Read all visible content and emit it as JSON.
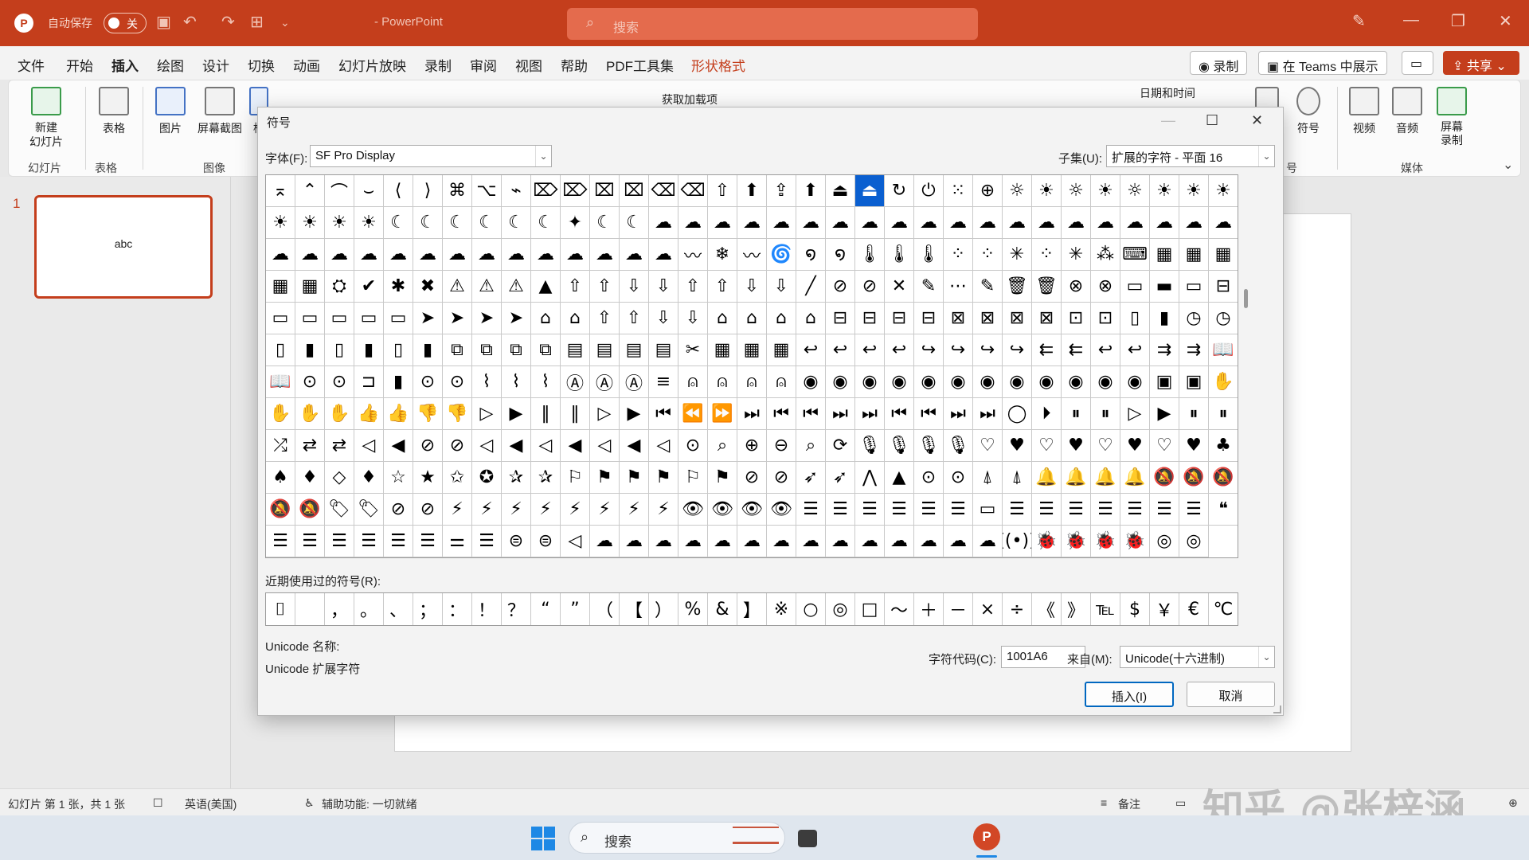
{
  "titlebar": {
    "logo": "P",
    "autosave_label": "自动保存",
    "autosave_state": "关",
    "doc_title": "- PowerPoint",
    "search_placeholder": "搜索",
    "icons": [
      "save-icon",
      "undo-icon",
      "redo-icon",
      "presentation-icon",
      "customize-icon",
      "pen-icon",
      "minimize-icon",
      "restore-icon",
      "close-icon"
    ]
  },
  "menu": {
    "tabs": [
      "文件",
      "开始",
      "插入",
      "绘图",
      "设计",
      "切换",
      "动画",
      "幻灯片放映",
      "录制",
      "审阅",
      "视图",
      "帮助",
      "PDF工具集",
      "形状格式"
    ],
    "active_tab": "插入",
    "record_btn": "录制",
    "teams_btn": "在 Teams 中展示",
    "share_btn": "共享"
  },
  "ribbon": {
    "new_slide": "新建\n幻灯片",
    "table": "表格",
    "picture": "图片",
    "screenshot": "屏幕截图",
    "get_addins": "获取加载项",
    "datetime": "日期和时间",
    "symbol": "符号",
    "video": "视频",
    "audio": "音频",
    "screen_record": "屏幕\n录制",
    "groups": {
      "slides": "幻灯片",
      "tables": "表格",
      "images": "图像",
      "symbols": "号",
      "media": "媒体"
    },
    "partial": "框"
  },
  "slides_panel": {
    "number": "1",
    "thumb_text": "abc"
  },
  "dialog": {
    "title": "符号",
    "font_label": "字体(F):",
    "font_value": "SF Pro Display",
    "subset_label": "子集(U):",
    "subset_value": "扩展的字符 - 平面 16",
    "recent_label": "近期使用过的符号(R):",
    "unicode_name_label": "Unicode 名称:",
    "unicode_name_value": "Unicode 扩展字符",
    "char_code_label": "字符代码(C):",
    "char_code_value": "1001A6",
    "from_label": "来自(M):",
    "from_value": "Unicode(十六进制)",
    "insert_btn": "插入(I)",
    "cancel_btn": "取消",
    "selected_index": 20,
    "symbols": [
      "⌅",
      "⌃",
      "⌒",
      "⌣",
      "⟨",
      "⟩",
      "⌘",
      "⌥",
      "⌁",
      "⌦",
      "⌦",
      "⌧",
      "⌧",
      "⌫",
      "⌫",
      "⇧",
      "⬆",
      "⇪",
      "⬆",
      "⏏",
      "⏏",
      "↻",
      "⏻",
      "⁙",
      "⊕",
      "☼",
      "☀",
      "☼",
      "☀",
      "☼",
      "☀",
      "☀",
      "☀",
      "☀",
      "☀",
      "☀",
      "☀",
      "☾",
      "☾",
      "☾",
      "☾",
      "☾",
      "☾",
      "✦",
      "☾",
      "☾",
      "☁",
      "☁",
      "☁",
      "☁",
      "☁",
      "☁",
      "☁",
      "☁",
      "☁",
      "☁",
      "☁",
      "☁",
      "☁",
      "☁",
      "☁",
      "☁",
      "☁",
      "☁",
      "☁",
      "☁",
      "☁",
      "☁",
      "☁",
      "☁",
      "☁",
      "☁",
      "☁",
      "☁",
      "☁",
      "☁",
      "☁",
      "☁",
      "☁",
      "☁",
      "〰",
      "❄",
      "〰",
      "🌀",
      "໑",
      "໑",
      "🌡",
      "🌡",
      "🌡",
      "⁘",
      "⁘",
      "✳",
      "⁘",
      "✳",
      "⁂",
      "⌨",
      "▦",
      "▦",
      "▦",
      "▦",
      "▦",
      "⛭",
      "✔",
      "✱",
      "✖",
      "⚠",
      "⚠",
      "⚠",
      "▲",
      "⇧",
      "⇧",
      "⇩",
      "⇩",
      "⇧",
      "⇧",
      "⇩",
      "⇩",
      "╱",
      "⊘",
      "⊘",
      "✕",
      "✎",
      "⋯",
      "✎",
      "🗑",
      "🗑",
      "⊗",
      "⊗",
      "▭",
      "▬",
      "▭",
      "⊟",
      "▭",
      "▭",
      "▭",
      "▭",
      "▭",
      "➤",
      "➤",
      "➤",
      "➤",
      "⌂",
      "⌂",
      "⇧",
      "⇧",
      "⇩",
      "⇩",
      "⌂",
      "⌂",
      "⌂",
      "⌂",
      "⊟",
      "⊟",
      "⊟",
      "⊟",
      "⊠",
      "⊠",
      "⊠",
      "⊠",
      "⊡",
      "⊡",
      "▯",
      "▮",
      "◷",
      "◷",
      "▯",
      "▮",
      "▯",
      "▮",
      "▯",
      "▮",
      "⧉",
      "⧉",
      "⧉",
      "⧉",
      "▤",
      "▤",
      "▤",
      "▤",
      "✂",
      "▦",
      "▦",
      "▦",
      "↩",
      "↩",
      "↩",
      "↩",
      "↪",
      "↪",
      "↪",
      "↪",
      "⇇",
      "⇇",
      "↩",
      "↩",
      "⇉",
      "⇉",
      "📖",
      "📖",
      "⊙",
      "⊙",
      "⊐",
      "▮",
      "⊙",
      "⊙",
      "⌇",
      "⌇",
      "⌇",
      "Ⓐ",
      "Ⓐ",
      "Ⓐ",
      "≡",
      "⍝",
      "⍝",
      "⍝",
      "⍝",
      "◉",
      "◉",
      "◉",
      "◉",
      "◉",
      "◉",
      "◉",
      "◉",
      "◉",
      "◉",
      "◉",
      "◉",
      "▣",
      "▣",
      "✋",
      "✋",
      "✋",
      "✋",
      "👍",
      "👍",
      "👎",
      "👎",
      "▷",
      "▶",
      "‖",
      "‖",
      "▷",
      "▶",
      "⏮",
      "⏪",
      "⏩",
      "⏭",
      "⏮",
      "⏮",
      "⏭",
      "⏭",
      "⏮",
      "⏮",
      "⏭",
      "⏭",
      "◯",
      "⏵",
      "⏸",
      "⏸",
      "▷",
      "▶",
      "⏸",
      "⏸",
      "⤮",
      "⇄",
      "⇄",
      "◁",
      "◀",
      "⊘",
      "⊘",
      "◁",
      "◀",
      "◁",
      "◀",
      "◁",
      "◀",
      "◁",
      "⊙",
      "⌕",
      "⊕",
      "⊖",
      "⌕",
      "⟳",
      "🎙",
      "🎙",
      "🎙",
      "🎙",
      "♡",
      "♥",
      "♡",
      "♥",
      "♡",
      "♥",
      "♡",
      "♥",
      "♣",
      "♠",
      "♦",
      "◇",
      "♦",
      "☆",
      "★",
      "✩",
      "✪",
      "✰",
      "✰",
      "⚐",
      "⚑",
      "⚑",
      "⚑",
      "⚐",
      "⚑",
      "⊘",
      "⊘",
      "➶",
      "➶",
      "⋀",
      "▲",
      "⊙",
      "⊙",
      "⍋",
      "⍋",
      "🔔",
      "🔔",
      "🔔",
      "🔔",
      "🔕",
      "🔕",
      "🔕",
      "🔕",
      "🔕",
      "🏷",
      "🏷",
      "⊘",
      "⊘",
      "⚡",
      "⚡",
      "⚡",
      "⚡",
      "⚡",
      "⚡",
      "⚡",
      "⚡",
      "👁",
      "👁",
      "👁",
      "👁",
      "☰",
      "☰",
      "☰",
      "☰",
      "☰",
      "☰",
      "▭",
      "☰",
      "☰",
      "☰",
      "☰",
      "☰",
      "☰",
      "☰",
      "❝",
      "☰",
      "☰",
      "☰",
      "☰",
      "☰",
      "☰",
      "⚌",
      "☰",
      "⊜",
      "⊜",
      "◁",
      "☁",
      "☁",
      "☁",
      "☁",
      "☁",
      "☁",
      "☁",
      "☁",
      "☁",
      "☁",
      "☁",
      "☁",
      "☁",
      "☁",
      "((•))",
      "🐞",
      "🐞",
      "🐞",
      "🐞",
      "◎",
      "◎"
    ],
    "recent": [
      "⌷",
      "",
      "，",
      "。",
      "、",
      "；",
      "：",
      "！",
      "？",
      "“",
      "”",
      "（",
      "【",
      "）",
      "%",
      "&",
      "】",
      "※",
      "○",
      "◎",
      "□",
      "～",
      "＋",
      "－",
      "×",
      "÷",
      "《",
      "》",
      "℡",
      "$",
      "￥",
      "€",
      "℃"
    ]
  },
  "statusbar": {
    "slide_info": "幻灯片 第 1 张，共 1 张",
    "language": "英语(美国)",
    "accessibility": "辅助功能: 一切就绪",
    "notes": "备注",
    "watermark": "知乎 @张梓涵"
  },
  "taskbar": {
    "search": "搜索"
  }
}
